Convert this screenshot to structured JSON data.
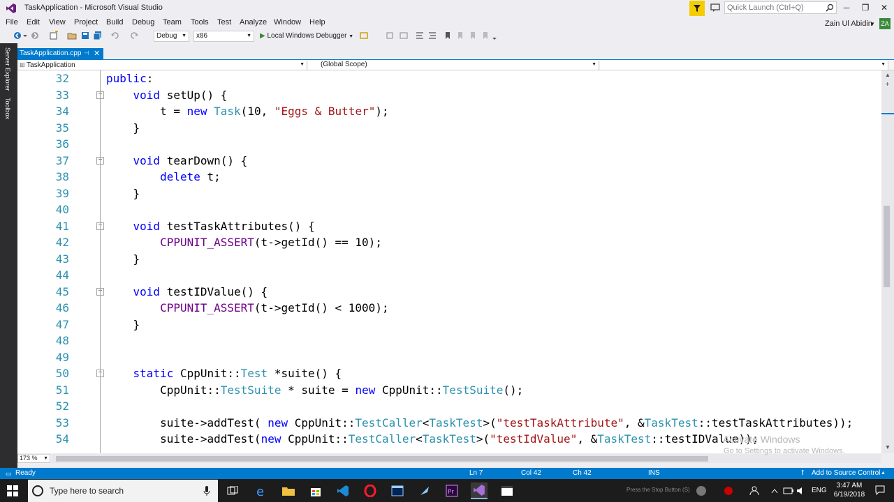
{
  "window": {
    "title": "TaskApplication - Microsoft Visual Studio",
    "minimize": "─",
    "maximize": "❐",
    "close": "✕"
  },
  "quick_launch": {
    "placeholder": "Quick Launch (Ctrl+Q)"
  },
  "menu": [
    "File",
    "Edit",
    "View",
    "Project",
    "Build",
    "Debug",
    "Team",
    "Tools",
    "Test",
    "Analyze",
    "Window",
    "Help"
  ],
  "user": {
    "name": "Zain Ul Abidin",
    "initials": "ZA"
  },
  "toolbar": {
    "configuration": "Debug",
    "platform": "x86",
    "debugger": "Local Windows Debugger"
  },
  "side_tabs": [
    "Server Explorer",
    "Toolbox"
  ],
  "document_tab": {
    "label": "TaskApplication.cpp",
    "pin": "⊣",
    "close": "✕"
  },
  "navigation": {
    "project": "TaskApplication",
    "scope": "(Global Scope)"
  },
  "editor": {
    "zoom": "173 %",
    "lines": [
      {
        "n": "32",
        "html": "<span class=\"kw\">public</span>:"
      },
      {
        "n": "33",
        "html": "    <span class=\"kw\">void</span> setUp() {"
      },
      {
        "n": "34",
        "html": "        t = <span class=\"kw\">new</span> <span class=\"ty\">Task</span>(10, <span class=\"st\">\"Eggs &amp; Butter\"</span>);"
      },
      {
        "n": "35",
        "html": "    }"
      },
      {
        "n": "36",
        "html": ""
      },
      {
        "n": "37",
        "html": "    <span class=\"kw\">void</span> tearDown() {"
      },
      {
        "n": "38",
        "html": "        <span class=\"kw\">delete</span> t;"
      },
      {
        "n": "39",
        "html": "    }"
      },
      {
        "n": "40",
        "html": ""
      },
      {
        "n": "41",
        "html": "    <span class=\"kw\">void</span> testTaskAttributes() {"
      },
      {
        "n": "42",
        "html": "        <span class=\"mc\">CPPUNIT_ASSERT</span>(t-&gt;getId() == 10);"
      },
      {
        "n": "43",
        "html": "    }"
      },
      {
        "n": "44",
        "html": ""
      },
      {
        "n": "45",
        "html": "    <span class=\"kw\">void</span> testIDValue() {"
      },
      {
        "n": "46",
        "html": "        <span class=\"mc\">CPPUNIT_ASSERT</span>(t-&gt;getId() &lt; 1000);"
      },
      {
        "n": "47",
        "html": "    }"
      },
      {
        "n": "48",
        "html": ""
      },
      {
        "n": "49",
        "html": ""
      },
      {
        "n": "50",
        "html": "    <span class=\"kw\">static</span> CppUnit::<span class=\"ty\">Test</span> *suite() {"
      },
      {
        "n": "51",
        "html": "        CppUnit::<span class=\"ty\">TestSuite</span> * suite = <span class=\"kw\">new</span> CppUnit::<span class=\"ty\">TestSuite</span>();"
      },
      {
        "n": "52",
        "html": ""
      },
      {
        "n": "53",
        "html": "        suite-&gt;addTest( <span class=\"kw\">new</span> CppUnit::<span class=\"ty\">TestCaller</span>&lt;<span class=\"ty\">TaskTest</span>&gt;(<span class=\"st\">\"testTaskAttribute\"</span>, &amp;<span class=\"ty\">TaskTest</span>::testTaskAttributes));"
      },
      {
        "n": "54",
        "html": "        suite-&gt;addTest(<span class=\"kw\">new</span> CppUnit::<span class=\"ty\">TestCaller</span>&lt;<span class=\"ty\">TaskTest</span>&gt;(<span class=\"st\">\"testIdValue\"</span>, &amp;<span class=\"ty\">TaskTest</span>::testIDValue));"
      }
    ],
    "folds": [
      "33",
      "37",
      "41",
      "45",
      "50"
    ]
  },
  "watermark": {
    "title": "Activate Windows",
    "subtitle": "Go to Settings to activate Windows."
  },
  "status": {
    "ready": "Ready",
    "line": "Ln 7",
    "col": "Col 42",
    "ch": "Ch 42",
    "mode": "INS",
    "source_control": "Add to Source Control"
  },
  "taskbar": {
    "search_placeholder": "Type here to search",
    "tray_text": "Press the Stop Button (S)",
    "lang": "ENG",
    "time": "3:47 AM",
    "date": "6/19/2018"
  },
  "colors": {
    "accent": "#007acc",
    "keyword": "#0000ff",
    "type": "#2b91af",
    "string": "#a31515",
    "macro": "#6f008a"
  }
}
